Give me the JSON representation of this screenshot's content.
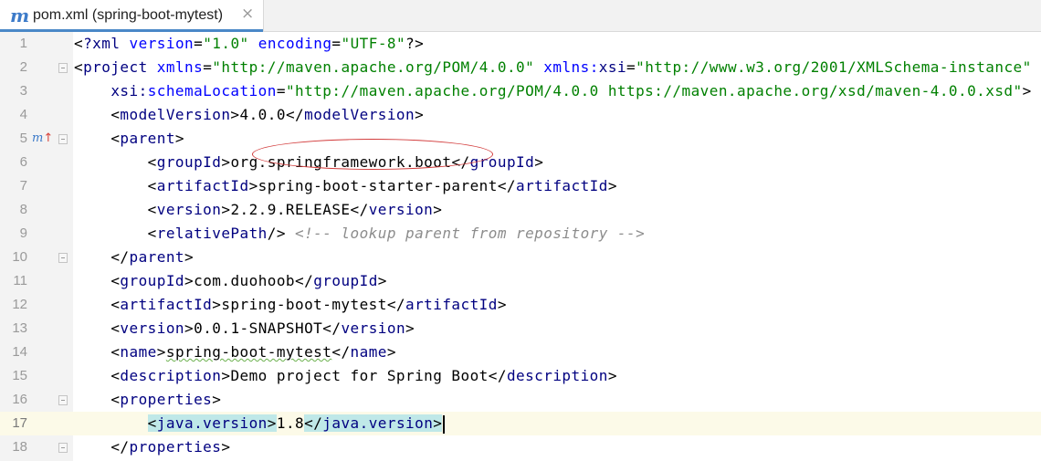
{
  "tab": {
    "icon": "maven-m-icon",
    "icon_glyph": "m",
    "label": "pom.xml (spring-boot-mytest)",
    "close_glyph": "×"
  },
  "gutter_marker": {
    "icon": "maven-override-arrow-icon",
    "m": "m",
    "arrow": "↑"
  },
  "lines": [
    {
      "n": "1"
    },
    {
      "n": "2"
    },
    {
      "n": "3"
    },
    {
      "n": "4"
    },
    {
      "n": "5"
    },
    {
      "n": "6"
    },
    {
      "n": "7"
    },
    {
      "n": "8"
    },
    {
      "n": "9"
    },
    {
      "n": "10"
    },
    {
      "n": "11"
    },
    {
      "n": "12"
    },
    {
      "n": "13"
    },
    {
      "n": "14"
    },
    {
      "n": "15"
    },
    {
      "n": "16"
    },
    {
      "n": "17"
    },
    {
      "n": "18"
    }
  ],
  "code": {
    "l1_decl": "?xml",
    "l1_version_attr": "version",
    "l1_version_val": "\"1.0\"",
    "l1_enc_attr": "encoding",
    "l1_enc_val": "\"UTF-8\"",
    "l2_tag": "project",
    "l2_xmlns_attr": "xmlns",
    "l2_xmlns_val": "\"http://maven.apache.org/POM/4.0.0\"",
    "l2_xsi_prefix": "xmlns:",
    "l2_xsi_name": "xsi",
    "l2_xsi_val": "\"http://www.w3.org/2001/XMLSchema-instance\"",
    "l3_attr_prefix": "xsi:",
    "l3_attr_name": "schemaLocation",
    "l3_val": "\"http://maven.apache.org/POM/4.0.0 https://maven.apache.org/xsd/maven-4.0.0.xsd\"",
    "l4_tag": "modelVersion",
    "l4_text": "4.0.0",
    "l5_tag": "parent",
    "l6_tag": "groupId",
    "l6_text": "org.springframework.boot",
    "l7_tag": "artifactId",
    "l7_text": "spring-boot-starter-parent",
    "l8_tag": "version",
    "l8_text": "2.2.9.RELEASE",
    "l9_tag": "relativePath",
    "l9_comment": "<!-- lookup parent from repository -->",
    "l10_tag": "parent",
    "l11_tag": "groupId",
    "l11_text": "com.duohoob",
    "l12_tag": "artifactId",
    "l12_text": "spring-boot-mytest",
    "l13_tag": "version",
    "l13_text": "0.0.1-SNAPSHOT",
    "l14_tag": "name",
    "l14_text": "spring-boot-mytest",
    "l15_tag": "description",
    "l15_text": "Demo project for Spring Boot",
    "l16_tag": "properties",
    "l17_tag": "java.version",
    "l17_text": "1.8",
    "l18_tag": "properties"
  },
  "colors": {
    "tag": "#000080",
    "attr": "#0000ff",
    "value": "#008000",
    "comment": "#8c8c8c",
    "annotation": "#d23a3a",
    "current_line": "#fcfae8",
    "tag_match": "#bfe8e8"
  }
}
